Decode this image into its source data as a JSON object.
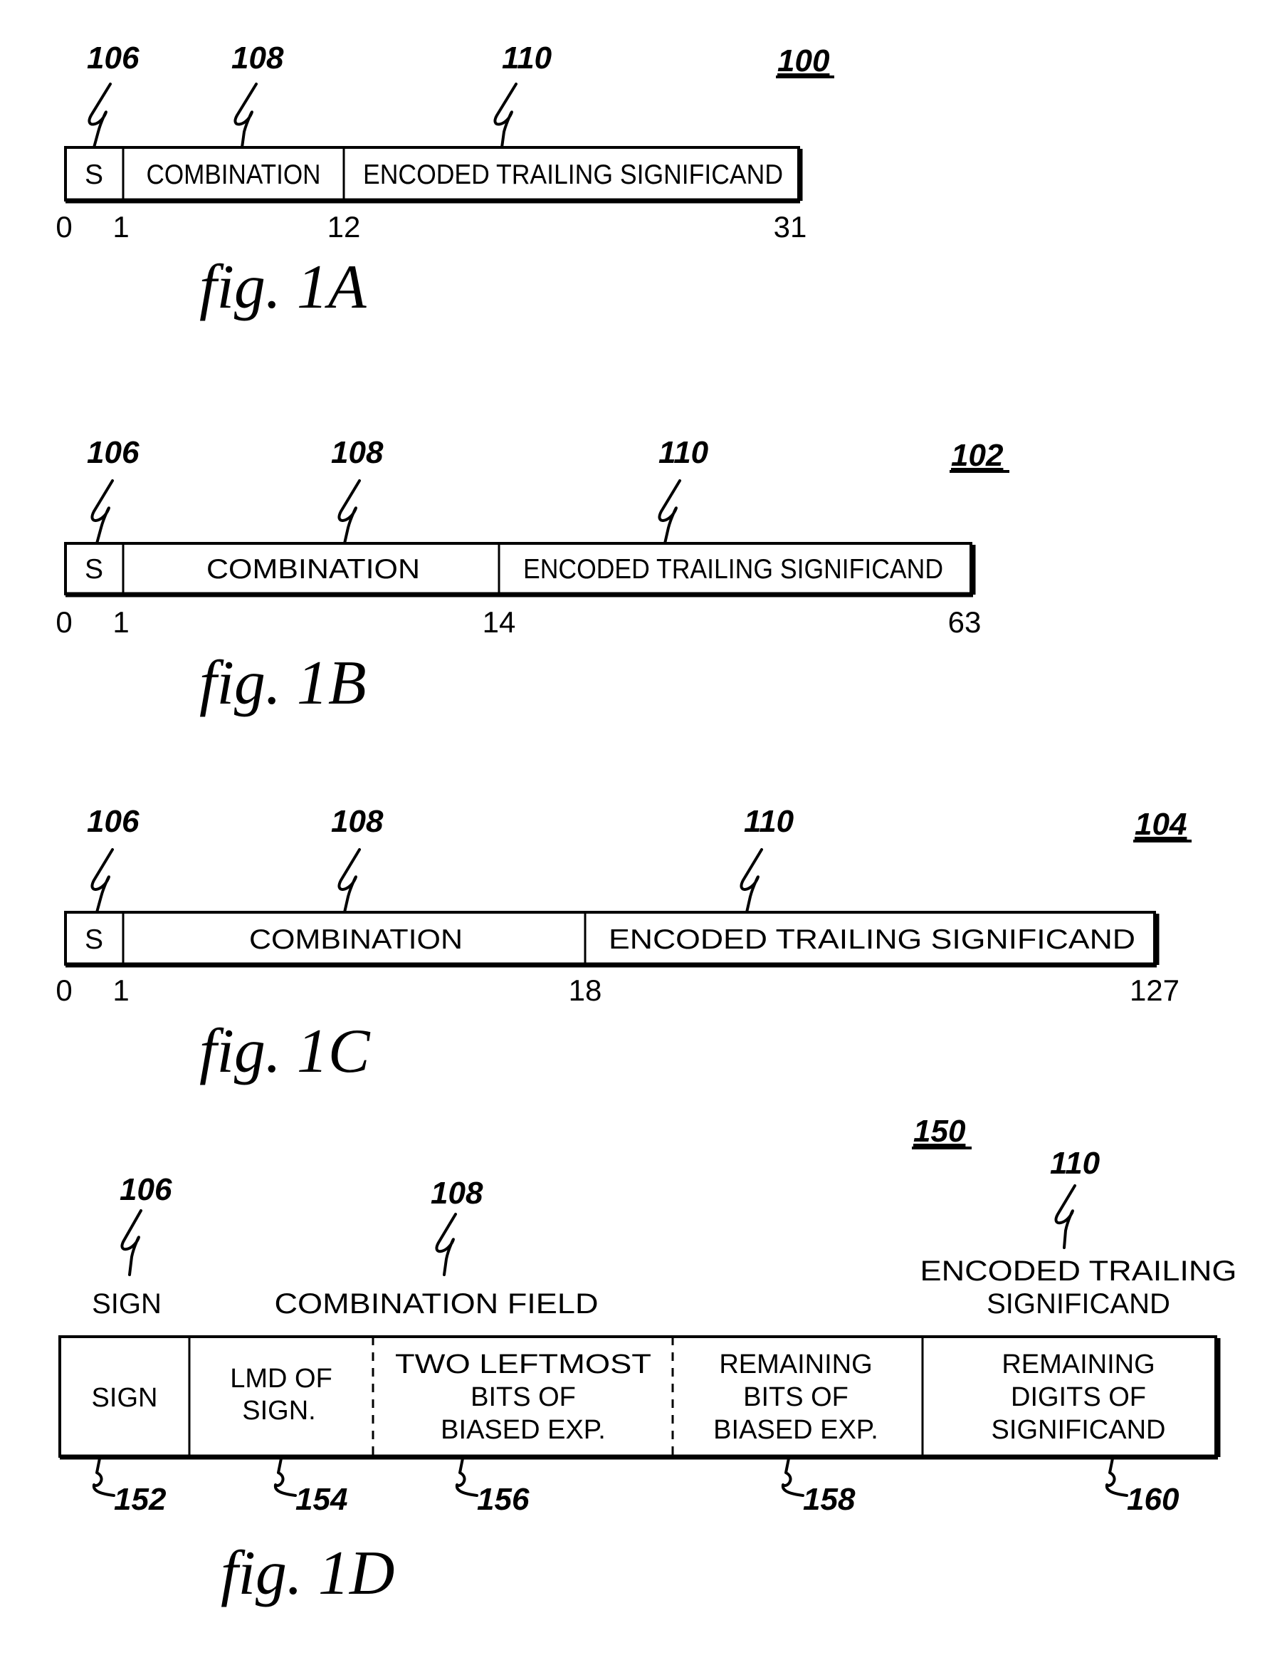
{
  "figures": [
    {
      "id": "1A",
      "caption": "fig. 1A",
      "figure_ref": "100",
      "fields": [
        {
          "ref": "106",
          "label": "S"
        },
        {
          "ref": "108",
          "label": "COMBINATION"
        },
        {
          "ref": "110",
          "label": "ENCODED TRAILING SIGNIFICAND"
        }
      ],
      "bit_positions": [
        "0",
        "1",
        "12",
        "31"
      ]
    },
    {
      "id": "1B",
      "caption": "fig. 1B",
      "figure_ref": "102",
      "fields": [
        {
          "ref": "106",
          "label": "S"
        },
        {
          "ref": "108",
          "label": "COMBINATION"
        },
        {
          "ref": "110",
          "label": "ENCODED TRAILING SIGNIFICAND"
        }
      ],
      "bit_positions": [
        "0",
        "1",
        "14",
        "63"
      ]
    },
    {
      "id": "1C",
      "caption": "fig. 1C",
      "figure_ref": "104",
      "fields": [
        {
          "ref": "106",
          "label": "S"
        },
        {
          "ref": "108",
          "label": "COMBINATION"
        },
        {
          "ref": "110",
          "label": "ENCODED TRAILING SIGNIFICAND"
        }
      ],
      "bit_positions": [
        "0",
        "1",
        "18",
        "127"
      ]
    },
    {
      "id": "1D",
      "caption": "fig. 1D",
      "figure_ref": "150",
      "groups": [
        {
          "ref": "106",
          "label_lines": [
            "SIGN"
          ]
        },
        {
          "ref": "108",
          "label_lines": [
            "COMBINATION FIELD"
          ]
        },
        {
          "ref": "110",
          "label_lines": [
            "ENCODED TRAILING",
            "SIGNIFICAND"
          ]
        }
      ],
      "cells": [
        {
          "ref": "152",
          "lines": [
            "SIGN"
          ]
        },
        {
          "ref": "154",
          "lines": [
            "LMD OF",
            "SIGN."
          ]
        },
        {
          "ref": "156",
          "lines": [
            "TWO LEFTMOST",
            "BITS OF",
            "BIASED EXP."
          ]
        },
        {
          "ref": "158",
          "lines": [
            "REMAINING",
            "BITS OF",
            "BIASED EXP."
          ]
        },
        {
          "ref": "160",
          "lines": [
            "REMAINING",
            "DIGITS OF",
            "SIGNIFICAND"
          ]
        }
      ]
    }
  ]
}
